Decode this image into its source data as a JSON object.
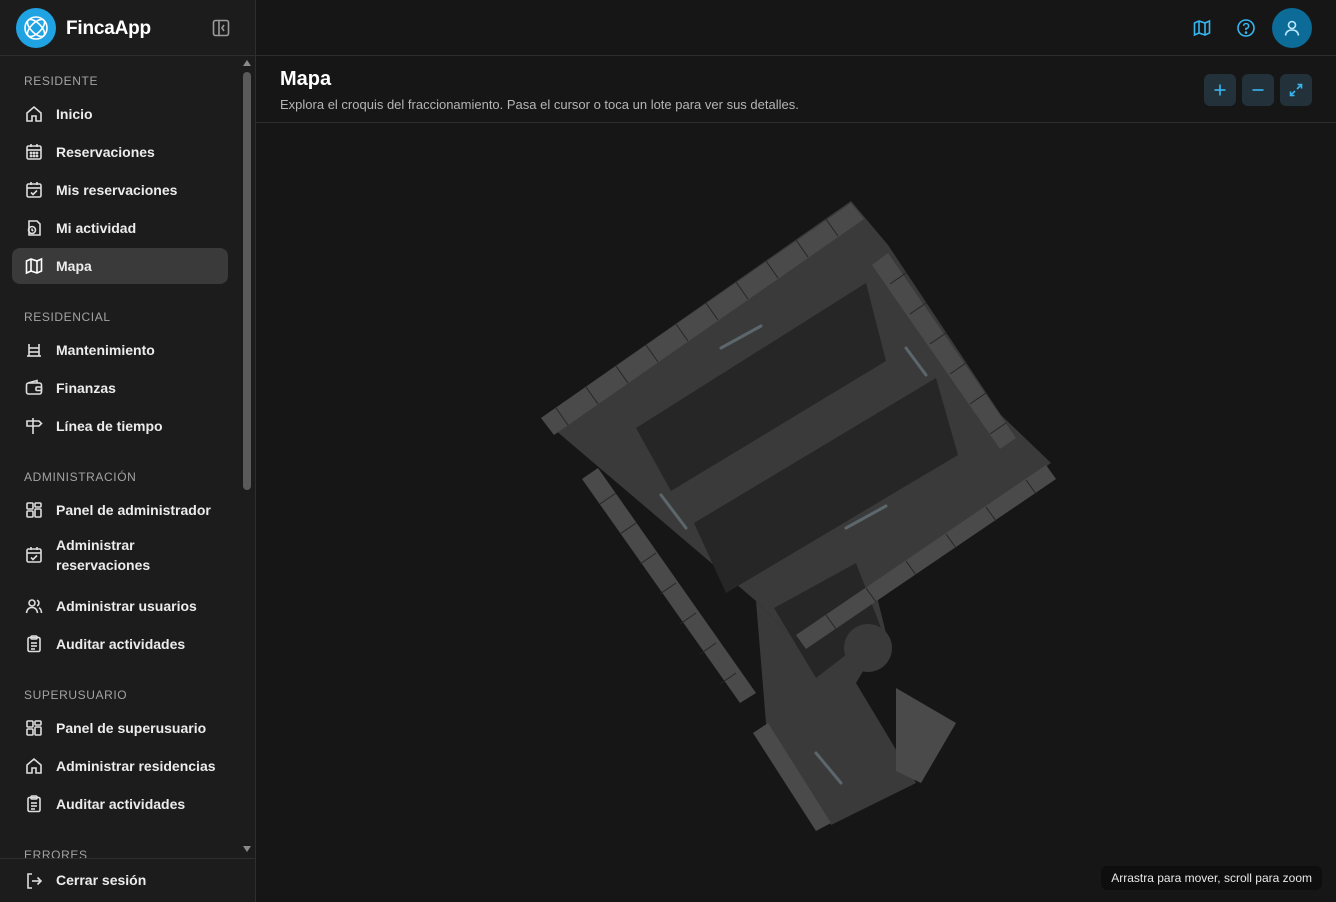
{
  "brand": {
    "name": "FincaApp"
  },
  "sidebar": {
    "sections": [
      {
        "title": "RESIDENTE",
        "items": [
          "Inicio",
          "Reservaciones",
          "Mis reservaciones",
          "Mi actividad",
          "Mapa"
        ]
      },
      {
        "title": "RESIDENCIAL",
        "items": [
          "Mantenimiento",
          "Finanzas",
          "Línea de tiempo"
        ]
      },
      {
        "title": "ADMINISTRACIÓN",
        "items": [
          "Panel de administrador",
          "Administrar reservaciones",
          "Administrar usuarios",
          "Auditar actividades"
        ]
      },
      {
        "title": "SUPERUSUARIO",
        "items": [
          "Panel de superusuario",
          "Administrar residencias",
          "Auditar actividades"
        ]
      },
      {
        "title": "ERRORES",
        "items": []
      }
    ],
    "active_item": "Mapa",
    "logout_label": "Cerrar sesión"
  },
  "page": {
    "title": "Mapa",
    "subtitle": "Explora el croquis del fraccionamiento. Pasa el cursor o toca un lote para ver sus detalles."
  },
  "map": {
    "hint": "Arrastra para mover, scroll para zoom"
  },
  "icons": {
    "map_top": "map-icon",
    "help": "help-icon",
    "user": "user-icon"
  },
  "colors": {
    "accent": "#1fa3e3",
    "avatar": "#0c6b97",
    "active_item": "#3a3a3a"
  }
}
